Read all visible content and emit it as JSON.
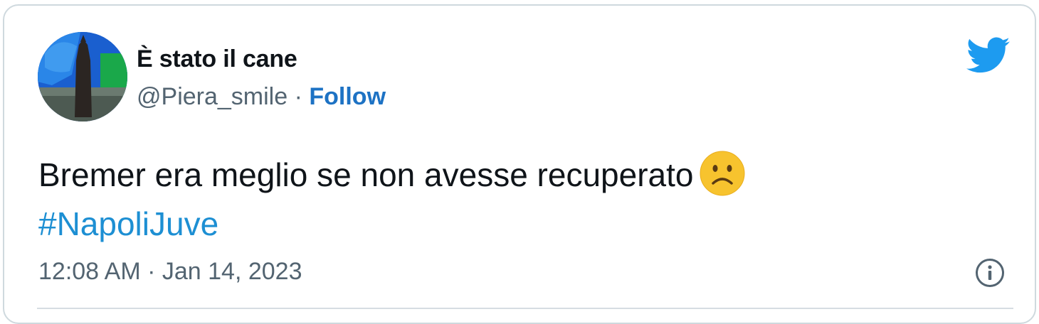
{
  "tweet": {
    "author": {
      "display_name": "È stato il cane",
      "handle": "@Piera_smile",
      "separator": "·",
      "follow_label": "Follow"
    },
    "text": "Bremer era meglio se non avesse recuperato",
    "emoji": "frowning-face-emoji",
    "hashtag": "#NapoliJuve",
    "timestamp": "12:08 AM · Jan 14, 2023",
    "icons": {
      "brand": "twitter-bird-icon",
      "info": "info-icon"
    },
    "colors": {
      "link": "#1d72c4",
      "hashtag": "#1d8fd3",
      "brand": "#1d9bf0",
      "secondary_text": "#536471"
    }
  }
}
